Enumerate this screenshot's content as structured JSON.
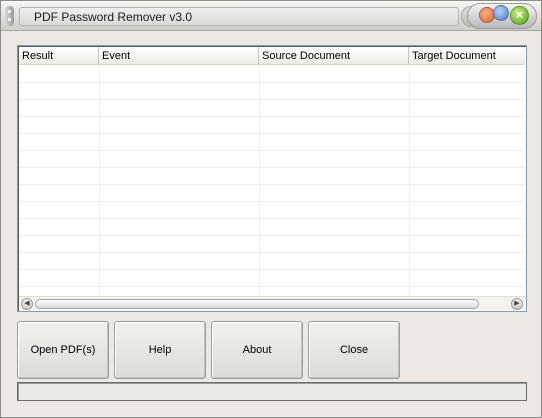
{
  "window": {
    "title": "PDF Password Remover v3.0",
    "close_glyph": "×"
  },
  "list": {
    "columns": [
      "Result",
      "Event",
      "Source Document",
      "Target Document"
    ],
    "rows": []
  },
  "scrollbar": {
    "left_glyph": "◀",
    "right_glyph": "▶"
  },
  "buttons": {
    "open": "Open PDF(s)",
    "help": "Help",
    "about": "About",
    "close": "Close"
  },
  "status": {
    "text": ""
  },
  "icons": {
    "grip": "grip-icon",
    "minimize": "minimize-icon",
    "maximize": "maximize-icon",
    "close": "close-icon"
  }
}
